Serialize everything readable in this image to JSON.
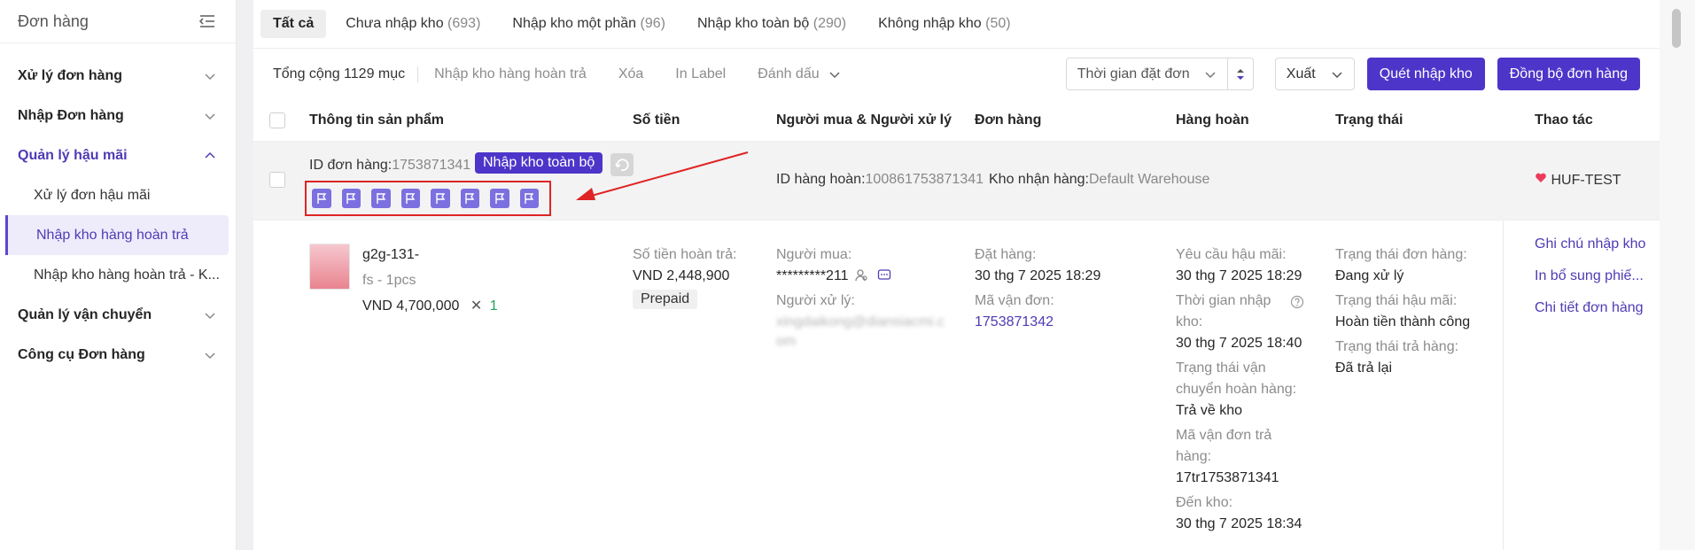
{
  "sidebar": {
    "title": "Đơn hàng",
    "groups": [
      {
        "label": "Xử lý đơn hàng"
      },
      {
        "label": "Nhập Đơn hàng"
      },
      {
        "label": "Quản lý hậu mãi"
      },
      {
        "label": "Quản lý vận chuyển"
      },
      {
        "label": "Công cụ Đơn hàng"
      }
    ],
    "sub_items": [
      {
        "label": "Xử lý đơn hậu mãi"
      },
      {
        "label": "Nhập kho hàng hoàn trả"
      },
      {
        "label": "Nhập kho hàng hoàn trả - K..."
      }
    ]
  },
  "tabs": [
    {
      "label": "Tất cả",
      "count": ""
    },
    {
      "label": "Chưa nhập kho",
      "count": "(693)"
    },
    {
      "label": "Nhập kho một phần",
      "count": "(96)"
    },
    {
      "label": "Nhập kho toàn bộ",
      "count": "(290)"
    },
    {
      "label": "Không nhập kho",
      "count": "(50)"
    }
  ],
  "toolbar": {
    "total": "Tổng cộng 1129 mục",
    "actions": [
      "Nhập kho hàng hoàn trả",
      "Xóa",
      "In Label",
      "Đánh dấu"
    ],
    "time_select": "Thời gian đặt đơn",
    "export": "Xuất",
    "scan_button": "Quét nhập kho",
    "sync_button": "Đồng bộ đơn hàng"
  },
  "table": {
    "headers": [
      "Thông tin sản phẩm",
      "Số tiền",
      "Người mua & Người xử lý",
      "Đơn hàng",
      "Hàng hoàn",
      "Trạng thái",
      "Thao tác"
    ]
  },
  "group": {
    "order_id_label": "ID đơn hàng:",
    "order_id": "1753871341",
    "tag": "Nhập kho toàn bộ",
    "return_id_label": "ID hàng hoàn:",
    "return_id": "100861753871341",
    "warehouse_label": "Kho nhận hàng:",
    "warehouse": "Default Warehouse",
    "shop": "HUF-TEST",
    "flag_color": "#7c70e0",
    "highlight_color": "#e02424"
  },
  "row": {
    "product_name": "g2g-131-",
    "product_variant": "fs - 1pcs",
    "product_price": "VND 4,700,000",
    "product_qty_x": "✕",
    "product_qty": "1",
    "refund_label": "Số tiền hoàn trả:",
    "refund_amount": "VND 2,448,900",
    "payment_tag": "Prepaid",
    "buyer_label": "Người mua:",
    "buyer": "*********211",
    "handler_label": "Người xử lý:",
    "handler_line1": "xingdaikong@diansiacmi.c",
    "handler_line2": "om",
    "order_placed_label": "Đặt hàng:",
    "order_placed": "30 thg 7 2025 18:29",
    "tracking_label": "Mã vận đơn:",
    "tracking": "1753871342",
    "after_sale_req_label": "Yêu cầu hậu mãi:",
    "after_sale_req": "30 thg 7 2025 18:29",
    "warehouse_time_label1": "Thời gian nhập",
    "warehouse_time_label2": "kho:",
    "warehouse_time": "30 thg 7 2025 18:40",
    "return_ship_status_label1": "Trạng thái vận",
    "return_ship_status_label2": "chuyển hoàn hàng:",
    "return_ship_status": "Trả về kho",
    "return_tracking_label1": "Mã vận đơn trả",
    "return_tracking_label2": "hàng:",
    "return_tracking": "17tr1753871341",
    "arrive_label": "Đến kho:",
    "arrive": "30 thg 7 2025 18:34",
    "order_status_label": "Trạng thái đơn hàng:",
    "order_status": "Đang xử lý",
    "after_sale_status_label": "Trạng thái hậu mãi:",
    "after_sale_status": "Hoàn tiền thành công",
    "return_status_label": "Trạng thái trả hàng:",
    "return_status": "Đã trả lại",
    "action_note": "Ghi chú nhập kho",
    "action_print": "In bổ sung phiế...",
    "action_detail": "Chi tiết đơn hàng"
  }
}
